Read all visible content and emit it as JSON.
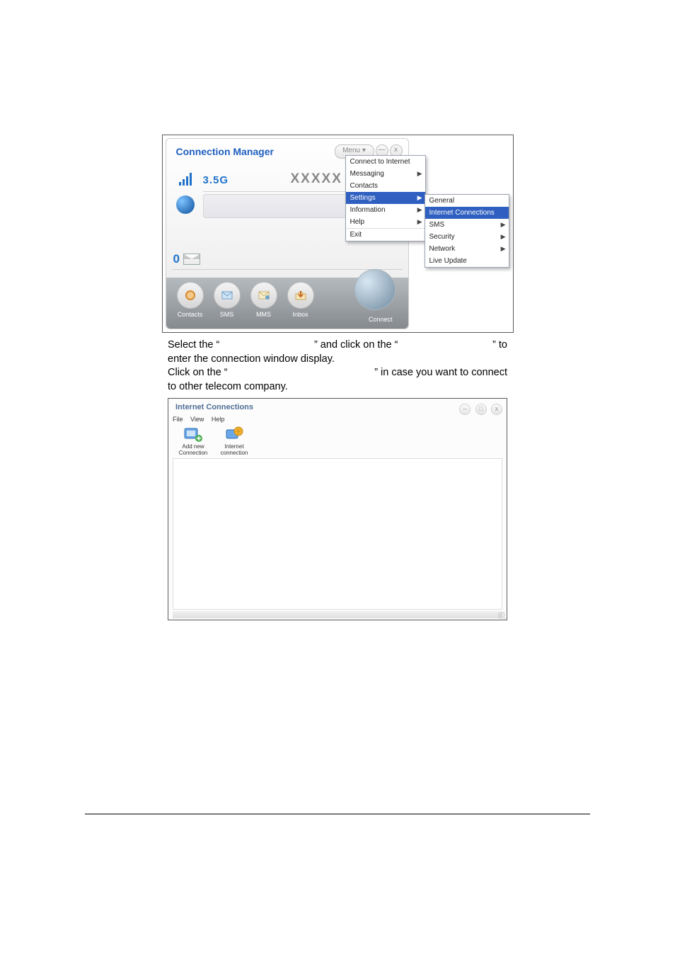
{
  "cm": {
    "title": "Connection Manager",
    "menu_button": "Menu ▾",
    "minimize": "—",
    "close": "x",
    "generation": "3.5G",
    "operator": "XXXXX",
    "unread_count": "0",
    "bottom": {
      "contacts": "Contacts",
      "sms": "SMS",
      "mms": "MMS",
      "inbox": "Inbox",
      "connect": "Connect"
    }
  },
  "menu": {
    "items": [
      {
        "label": "Connect to Internet",
        "has_sub": false
      },
      {
        "label": "Messaging",
        "has_sub": true
      },
      {
        "label": "Contacts",
        "has_sub": false
      },
      {
        "label": "Settings",
        "has_sub": true,
        "highlight": true
      },
      {
        "label": "Information",
        "has_sub": true
      },
      {
        "label": "Help",
        "has_sub": true
      },
      {
        "label": "Exit",
        "has_sub": false,
        "sep": true
      }
    ],
    "settings_sub": [
      {
        "label": "General"
      },
      {
        "label": "Internet Connections",
        "highlight": true
      },
      {
        "label": "SMS",
        "has_sub": true
      },
      {
        "label": "Security",
        "has_sub": true
      },
      {
        "label": "Network",
        "has_sub": true
      },
      {
        "label": "Live Update"
      }
    ]
  },
  "instr": {
    "l1a": "Select the “",
    "l1b": "” and click on the “",
    "l1c": "” to",
    "l2": "enter the connection window display.",
    "l3a": "Click on the “",
    "l3b": "” in case you want to connect",
    "l4": "to other telecom company."
  },
  "ic": {
    "title": "Internet Connections",
    "menubar": {
      "file": "File",
      "view": "View",
      "help": "Help"
    },
    "toolbar": {
      "add1": "Add new",
      "add2": "Connection",
      "net1": "Internet",
      "net2": "connection"
    },
    "win": {
      "min": "–",
      "max": "□",
      "close": "x"
    }
  }
}
